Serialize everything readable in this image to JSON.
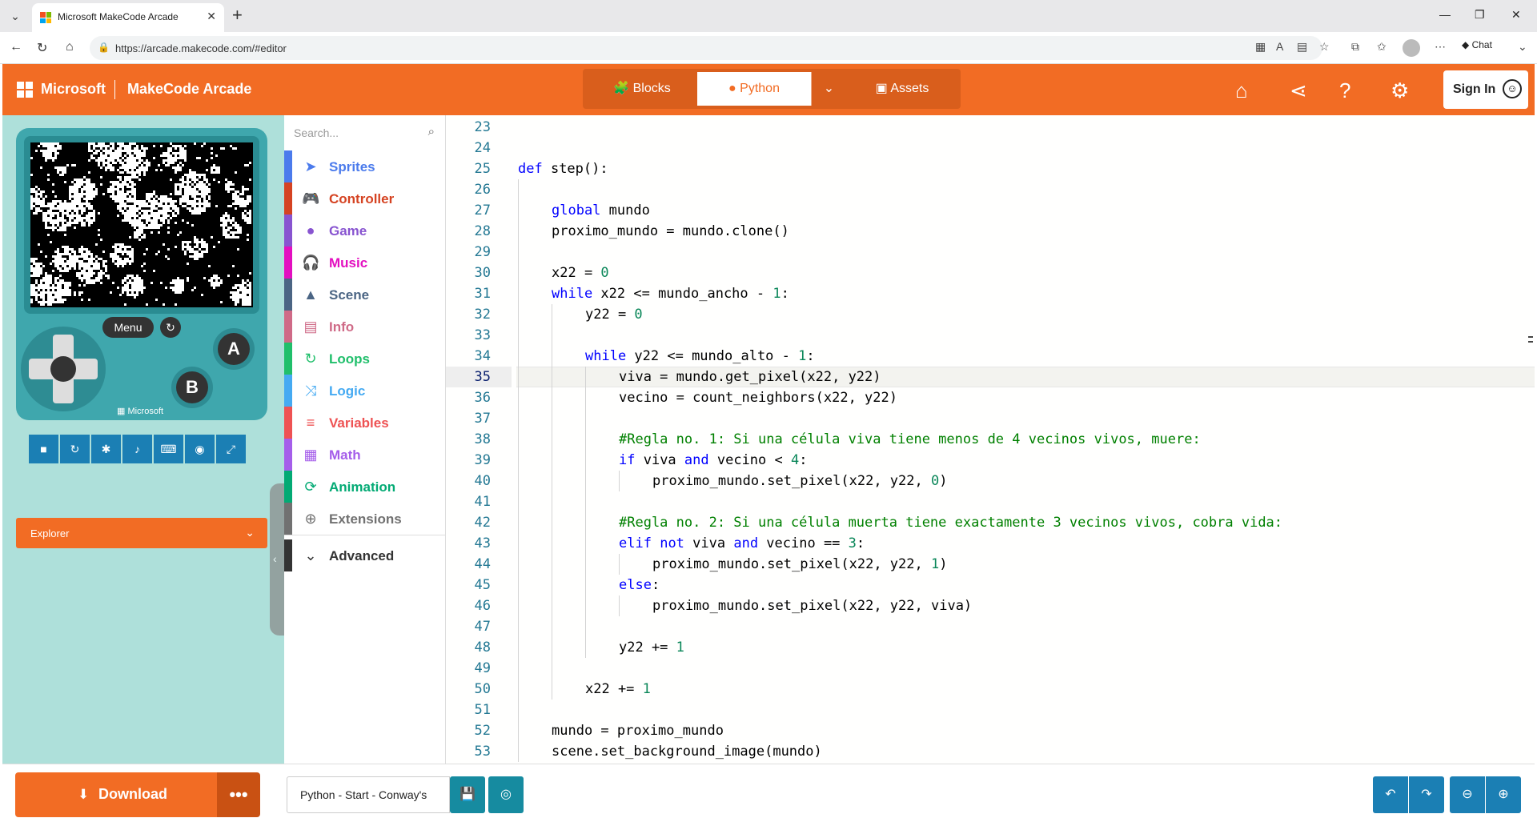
{
  "browser": {
    "tab_title": "Microsoft MakeCode Arcade",
    "url": "https://arcade.makecode.com/#editor",
    "chat_label": "Chat"
  },
  "header": {
    "brand": "Microsoft",
    "product": "MakeCode Arcade",
    "toggle": {
      "blocks": "Blocks",
      "python": "Python",
      "assets": "Assets",
      "active": "Python"
    },
    "sign_in": "Sign In",
    "accent_color": "#f26c24"
  },
  "simulator": {
    "menu_label": "Menu",
    "a_label": "A",
    "b_label": "B",
    "pad_brand": "Microsoft",
    "tools": [
      "stop-icon",
      "restart-icon",
      "debug-icon",
      "sound-icon",
      "keyboard-icon",
      "screenshot-icon",
      "fullscreen-icon"
    ]
  },
  "explorer": {
    "label": "Explorer"
  },
  "toolbox": {
    "search_placeholder": "Search...",
    "categories": [
      {
        "label": "Sprites",
        "color": "#4b7bec",
        "icon": "paper-plane-icon"
      },
      {
        "label": "Controller",
        "color": "#d54322",
        "icon": "gamepad-icon"
      },
      {
        "label": "Game",
        "color": "#8854d0",
        "icon": "circle-icon"
      },
      {
        "label": "Music",
        "color": "#e30fc0",
        "icon": "headphones-icon"
      },
      {
        "label": "Scene",
        "color": "#4b6584",
        "icon": "tree-icon"
      },
      {
        "label": "Info",
        "color": "#cf6a87",
        "icon": "id-card-icon"
      },
      {
        "label": "Loops",
        "color": "#20bf6b",
        "icon": "refresh-icon"
      },
      {
        "label": "Logic",
        "color": "#45aaf2",
        "icon": "shuffle-icon"
      },
      {
        "label": "Variables",
        "color": "#ee5253",
        "icon": "list-icon"
      },
      {
        "label": "Math",
        "color": "#a55eea",
        "icon": "calculator-icon"
      },
      {
        "label": "Animation",
        "color": "#03aa74",
        "icon": "sync-icon"
      },
      {
        "label": "Extensions",
        "color": "#717171",
        "icon": "plus-circle-icon"
      }
    ],
    "advanced": "Advanced"
  },
  "editor": {
    "active_line": "35",
    "lines": [
      {
        "n": "23",
        "i": 0,
        "t": ""
      },
      {
        "n": "24",
        "i": 0,
        "t": ""
      },
      {
        "n": "25",
        "i": 0,
        "t": "def step():"
      },
      {
        "n": "26",
        "i": 1,
        "t": ""
      },
      {
        "n": "27",
        "i": 1,
        "t": "global mundo"
      },
      {
        "n": "28",
        "i": 1,
        "t": "proximo_mundo = mundo.clone()"
      },
      {
        "n": "29",
        "i": 1,
        "t": ""
      },
      {
        "n": "30",
        "i": 1,
        "t": "x22 = 0"
      },
      {
        "n": "31",
        "i": 1,
        "t": "while x22 <= mundo_ancho - 1:"
      },
      {
        "n": "32",
        "i": 2,
        "t": "y22 = 0"
      },
      {
        "n": "33",
        "i": 2,
        "t": ""
      },
      {
        "n": "34",
        "i": 2,
        "t": "while y22 <= mundo_alto - 1:"
      },
      {
        "n": "35",
        "i": 3,
        "t": "viva = mundo.get_pixel(x22, y22)"
      },
      {
        "n": "36",
        "i": 3,
        "t": "vecino = count_neighbors(x22, y22)"
      },
      {
        "n": "37",
        "i": 3,
        "t": ""
      },
      {
        "n": "38",
        "i": 3,
        "t": "#Regla no. 1: Si una célula viva tiene menos de 4 vecinos vivos, muere:"
      },
      {
        "n": "39",
        "i": 3,
        "t": "if viva and vecino < 4:"
      },
      {
        "n": "40",
        "i": 4,
        "t": "proximo_mundo.set_pixel(x22, y22, 0)"
      },
      {
        "n": "41",
        "i": 3,
        "t": ""
      },
      {
        "n": "42",
        "i": 3,
        "t": "#Regla no. 2: Si una célula muerta tiene exactamente 3 vecinos vivos, cobra vida:"
      },
      {
        "n": "43",
        "i": 3,
        "t": "elif not viva and vecino == 3:"
      },
      {
        "n": "44",
        "i": 4,
        "t": "proximo_mundo.set_pixel(x22, y22, 1)"
      },
      {
        "n": "45",
        "i": 3,
        "t": "else:"
      },
      {
        "n": "46",
        "i": 4,
        "t": "proximo_mundo.set_pixel(x22, y22, viva)"
      },
      {
        "n": "47",
        "i": 3,
        "t": ""
      },
      {
        "n": "48",
        "i": 3,
        "t": "y22 += 1"
      },
      {
        "n": "49",
        "i": 2,
        "t": ""
      },
      {
        "n": "50",
        "i": 2,
        "t": "x22 += 1"
      },
      {
        "n": "51",
        "i": 1,
        "t": ""
      },
      {
        "n": "52",
        "i": 1,
        "t": "mundo = proximo_mundo"
      },
      {
        "n": "53",
        "i": 1,
        "t": "scene.set_background_image(mundo)"
      }
    ]
  },
  "footer": {
    "download_label": "Download",
    "more_label": "•••",
    "project_name": "Python - Start - Conway's"
  }
}
